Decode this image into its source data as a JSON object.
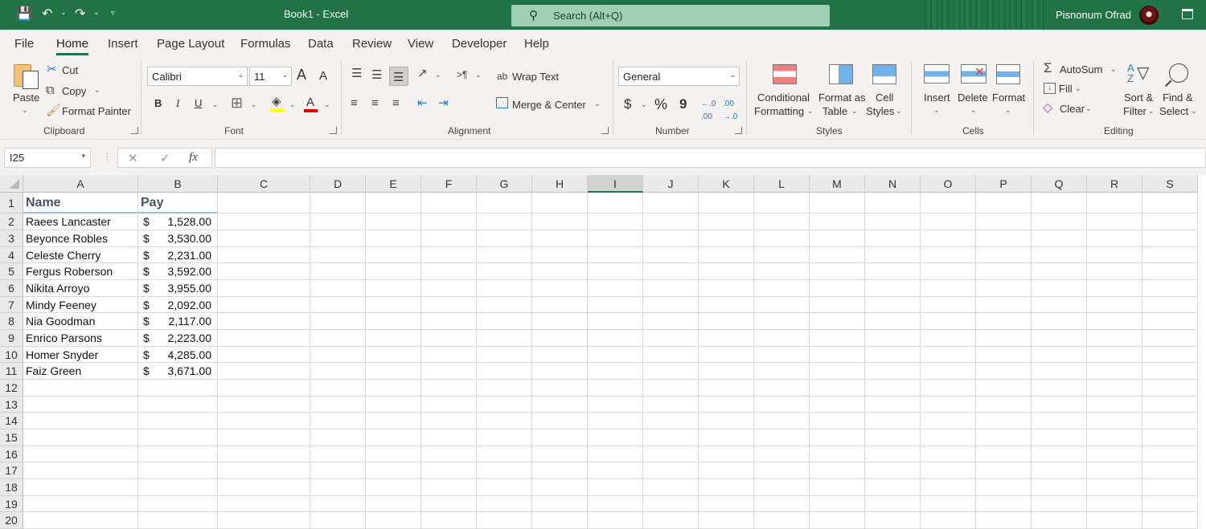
{
  "titlebar": {
    "title": "Book1  -  Excel",
    "search_placeholder": "Search (Alt+Q)",
    "user_name": "Pisnonum Ofrad",
    "icons": [
      "save-icon",
      "undo-icon",
      "redo-icon",
      "customize-qat-icon",
      "search-icon",
      "avatar",
      "ribbon-display-icon"
    ],
    "accent_color": "#217346"
  },
  "tabs": [
    "File",
    "Home",
    "Insert",
    "Page Layout",
    "Formulas",
    "Data",
    "Review",
    "View",
    "Developer",
    "Help"
  ],
  "active_tab": "Home",
  "ribbon": {
    "clipboard": {
      "label": "Clipboard",
      "paste": "Paste",
      "cut": "Cut",
      "copy": "Copy",
      "format_painter": "Format Painter"
    },
    "font": {
      "label": "Font",
      "font_name": "Calibri",
      "font_size": "11",
      "bold": "B",
      "italic": "I",
      "underline": "U",
      "grow": "A",
      "shrink": "A",
      "font_color": "A"
    },
    "alignment": {
      "label": "Alignment",
      "wrap_text": "Wrap Text",
      "merge_center": "Merge & Center"
    },
    "number": {
      "label": "Number",
      "format": "General",
      "currency": "$",
      "percent": "%",
      "comma": "9"
    },
    "styles": {
      "label": "Styles",
      "conditional_formatting_1": "Conditional",
      "conditional_formatting_2": "Formatting",
      "format_as_table_1": "Format as",
      "format_as_table_2": "Table",
      "cell_styles_1": "Cell",
      "cell_styles_2": "Styles"
    },
    "cells": {
      "label": "Cells",
      "insert": "Insert",
      "delete": "Delete",
      "format": "Format"
    },
    "editing": {
      "label": "Editing",
      "autosum": "AutoSum",
      "fill": "Fill",
      "clear": "Clear",
      "sort_filter_1": "Sort &",
      "sort_filter_2": "Filter",
      "find_select_1": "Find &",
      "find_select_2": "Select"
    }
  },
  "formula_bar": {
    "name_box": "I25",
    "fx": "fx",
    "cancel": "✕",
    "enter": "✓",
    "formula": ""
  },
  "sheet": {
    "columns": [
      "A",
      "B",
      "C",
      "D",
      "E",
      "F",
      "G",
      "H",
      "I",
      "J",
      "K",
      "L",
      "M",
      "N",
      "O",
      "P",
      "Q",
      "R",
      "S"
    ],
    "selected_column": "I",
    "rows": [
      "1",
      "2",
      "3",
      "4",
      "5",
      "6",
      "7",
      "8",
      "9",
      "10",
      "11",
      "12",
      "13",
      "14",
      "15",
      "16",
      "17",
      "18",
      "19",
      "20"
    ],
    "header": {
      "name": "Name",
      "pay": "Pay"
    },
    "currency_symbol": "$",
    "records": [
      {
        "name": "Raees Lancaster",
        "pay": "1,528.00"
      },
      {
        "name": "Beyonce Robles",
        "pay": "3,530.00"
      },
      {
        "name": "Celeste Cherry",
        "pay": "2,231.00"
      },
      {
        "name": "Fergus Roberson",
        "pay": "3,592.00"
      },
      {
        "name": "Nikita Arroyo",
        "pay": "3,955.00"
      },
      {
        "name": "Mindy Feeney",
        "pay": "2,092.00"
      },
      {
        "name": "Nia Goodman",
        "pay": "2,117.00"
      },
      {
        "name": "Enrico Parsons",
        "pay": "2,223.00"
      },
      {
        "name": "Homer Snyder",
        "pay": "4,285.00"
      },
      {
        "name": "Faiz Green",
        "pay": "3,671.00"
      }
    ]
  }
}
